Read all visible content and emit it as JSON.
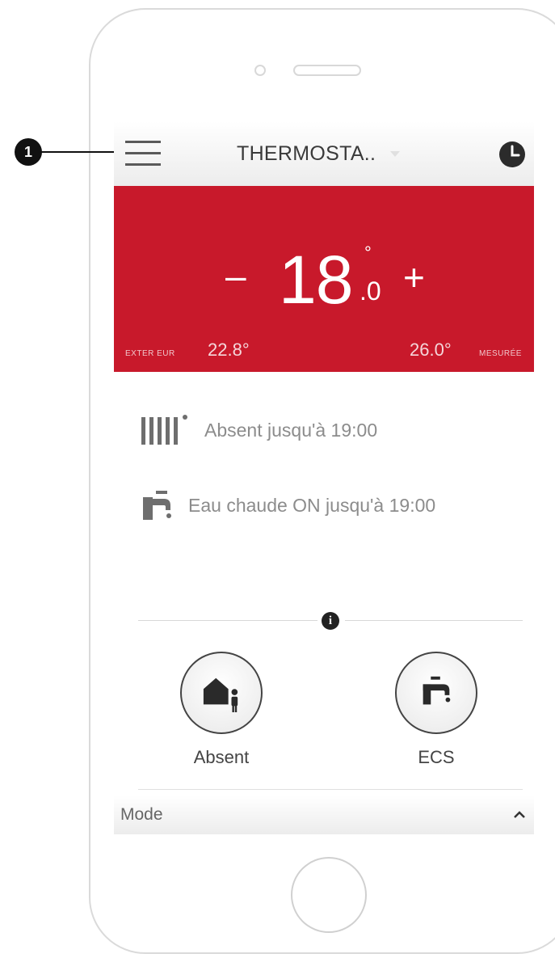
{
  "callout": {
    "number": "1"
  },
  "header": {
    "title": "THERMOSTA..",
    "menu_icon": "hamburger-menu-icon",
    "clock_icon": "clock-icon"
  },
  "temperature": {
    "minus": "–",
    "plus": "+",
    "integer": "18",
    "decimal": ".0",
    "degree": "°",
    "exterior_label": "EXTER EUR",
    "exterior_value": "22.8°",
    "measured_value": "26.0°",
    "measured_label": "MESURÉE",
    "background_color": "#c8192b"
  },
  "status": [
    {
      "icon": "radiator-icon",
      "text": "Absent jusqu'à 19:00"
    },
    {
      "icon": "faucet-icon",
      "text": "Eau chaude ON jusqu'à 19:00"
    }
  ],
  "info_icon": "i",
  "modes": [
    {
      "icon": "house-person-icon",
      "label": "Absent"
    },
    {
      "icon": "faucet-icon",
      "label": "ECS"
    }
  ],
  "footer": {
    "label": "Mode",
    "icon": "chevron-up-icon"
  }
}
